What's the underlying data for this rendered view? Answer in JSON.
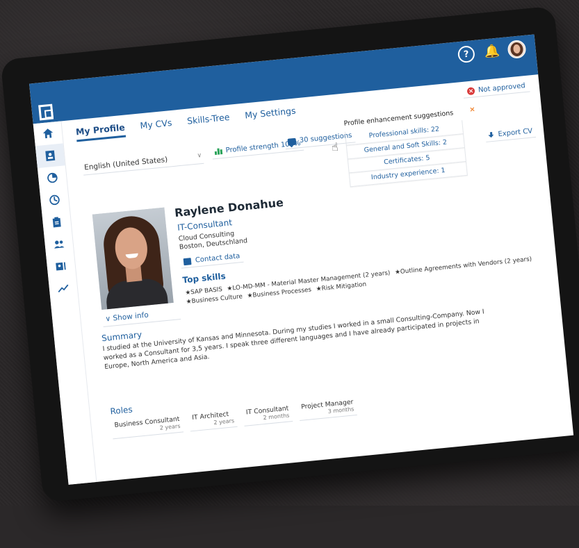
{
  "topbar": {
    "icons": [
      "help-icon",
      "bell-icon",
      "avatar"
    ],
    "help_glyph": "?"
  },
  "tabs": [
    {
      "label": "My Profile",
      "active": true
    },
    {
      "label": "My CVs"
    },
    {
      "label": "Skills-Tree"
    },
    {
      "label": "My Settings"
    }
  ],
  "sidebar": {
    "items": [
      "home-icon",
      "profile-icon",
      "chart-pie-icon",
      "clock-icon",
      "clipboard-icon",
      "people-icon",
      "id-card-icon",
      "trend-icon"
    ]
  },
  "status": {
    "label": "Not approved",
    "color": "#d93b3b"
  },
  "language": {
    "value": "English (United States)"
  },
  "strength": {
    "label": "Profile strength 100%"
  },
  "suggestions": {
    "label": "30 suggestions"
  },
  "enhancement": {
    "title": "Profile enhancement suggestions",
    "close": "×",
    "items": [
      "Professional skills: 22",
      "General and Soft Skills: 2",
      "Certificates: 5",
      "Industry experience: 1"
    ]
  },
  "export": {
    "label": "Export CV"
  },
  "profile": {
    "name": "Raylene Donahue",
    "title": "IT-Consultant",
    "company": "Cloud Consulting",
    "location": "Boston, Deutschland",
    "contact_label": "Contact data",
    "show_info": "Show info"
  },
  "top_skills": {
    "heading": "Top skills",
    "items": [
      "★SAP BASIS",
      "★LO-MD-MM - Material Master Management (2 years)",
      "★Outline Agreements with Vendors (2 years)",
      "★Business Culture",
      "★Business Processes",
      "★Risk Mitigation"
    ]
  },
  "summary": {
    "heading": "Summary",
    "text": "I studied at the University of Kansas and Minnesota. During my studies I worked in a small Consulting-Company. Now I worked as a Consultant for 3,5 years. I speak three different languages and I have already participated in projects in Europe, North America and Asia."
  },
  "roles": {
    "heading": "Roles",
    "items": [
      {
        "name": "Business Consultant",
        "duration": "2 years"
      },
      {
        "name": "IT Architect",
        "duration": "2 years"
      },
      {
        "name": "IT Consultant",
        "duration": "2 months"
      },
      {
        "name": "Project Manager",
        "duration": "3 months"
      }
    ]
  },
  "colors": {
    "brand": "#1f5f9e",
    "accent": "#2aa35a",
    "warn": "#f0812a"
  }
}
